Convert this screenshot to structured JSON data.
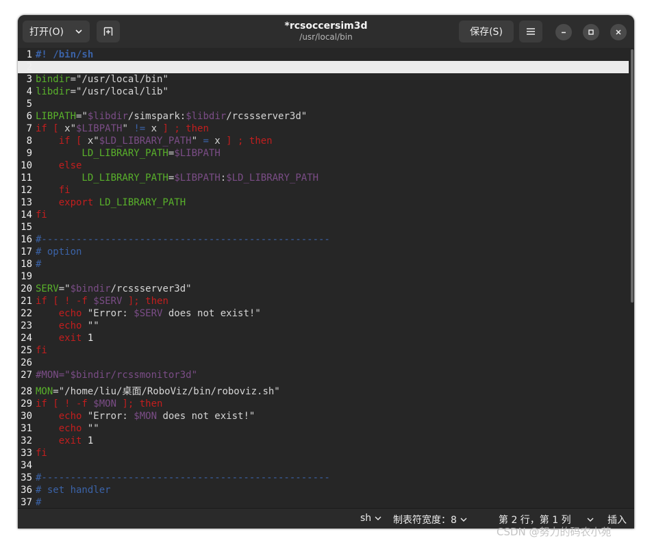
{
  "headerbar": {
    "open_label": "打开(O)",
    "title": "*rcsoccersim3d",
    "subtitle": "/usr/local/bin",
    "save_label": "保存(S)"
  },
  "code_lines": [
    {
      "n": "1",
      "tokens": [
        {
          "t": "#! /bin/sh",
          "c": "cmb"
        }
      ]
    },
    {
      "n": "2",
      "current": true,
      "tokens": []
    },
    {
      "n": "3",
      "tokens": [
        {
          "t": "bindir",
          "c": "var"
        },
        {
          "t": "=\"/usr/local/bin\"",
          "c": "str"
        }
      ]
    },
    {
      "n": "4",
      "tokens": [
        {
          "t": "libdir",
          "c": "var"
        },
        {
          "t": "=\"/usr/local/lib\"",
          "c": "str"
        }
      ]
    },
    {
      "n": "5",
      "tokens": []
    },
    {
      "n": "6",
      "tokens": [
        {
          "t": "LIBPATH",
          "c": "var"
        },
        {
          "t": "=\"",
          "c": "str"
        },
        {
          "t": "$libdir",
          "c": "sub"
        },
        {
          "t": "/simspark:",
          "c": "str"
        },
        {
          "t": "$libdir",
          "c": "sub"
        },
        {
          "t": "/rcssserver3d\"",
          "c": "str"
        }
      ]
    },
    {
      "n": "7",
      "tokens": [
        {
          "t": "if [ ",
          "c": "kw"
        },
        {
          "t": "x\"",
          "c": "str"
        },
        {
          "t": "$LIBPATH",
          "c": "sub"
        },
        {
          "t": "\" ",
          "c": "str"
        },
        {
          "t": "!=",
          "c": "cm"
        },
        {
          "t": " x ",
          "c": "str"
        },
        {
          "t": "] ; then",
          "c": "kw"
        }
      ]
    },
    {
      "n": "8",
      "tokens": [
        {
          "t": "    if [ ",
          "c": "kw"
        },
        {
          "t": "x\"",
          "c": "str"
        },
        {
          "t": "$LD_LIBRARY_PATH",
          "c": "sub"
        },
        {
          "t": "\" ",
          "c": "str"
        },
        {
          "t": "=",
          "c": "cm"
        },
        {
          "t": " x ",
          "c": "str"
        },
        {
          "t": "] ; then",
          "c": "kw"
        }
      ]
    },
    {
      "n": "9",
      "tokens": [
        {
          "t": "        LD_LIBRARY_PATH",
          "c": "var"
        },
        {
          "t": "=",
          "c": "str"
        },
        {
          "t": "$LIBPATH",
          "c": "sub"
        }
      ]
    },
    {
      "n": "10",
      "tokens": [
        {
          "t": "    else",
          "c": "kw"
        }
      ]
    },
    {
      "n": "11",
      "tokens": [
        {
          "t": "        LD_LIBRARY_PATH",
          "c": "var"
        },
        {
          "t": "=",
          "c": "str"
        },
        {
          "t": "$LIBPATH",
          "c": "sub"
        },
        {
          "t": ":",
          "c": "str"
        },
        {
          "t": "$LD_LIBRARY_PATH",
          "c": "sub"
        }
      ]
    },
    {
      "n": "12",
      "tokens": [
        {
          "t": "    fi",
          "c": "kw"
        }
      ]
    },
    {
      "n": "13",
      "tokens": [
        {
          "t": "    export ",
          "c": "kw"
        },
        {
          "t": "LD_LIBRARY_PATH",
          "c": "var"
        }
      ]
    },
    {
      "n": "14",
      "tokens": [
        {
          "t": "fi",
          "c": "kw"
        }
      ]
    },
    {
      "n": "15",
      "tokens": []
    },
    {
      "n": "16",
      "tokens": [
        {
          "t": "#--------------------------------------------------",
          "c": "cm"
        }
      ]
    },
    {
      "n": "17",
      "tokens": [
        {
          "t": "# option",
          "c": "cm"
        }
      ]
    },
    {
      "n": "18",
      "tokens": [
        {
          "t": "#",
          "c": "cm"
        }
      ]
    },
    {
      "n": "19",
      "tokens": []
    },
    {
      "n": "20",
      "tokens": [
        {
          "t": "SERV",
          "c": "var"
        },
        {
          "t": "=\"",
          "c": "str"
        },
        {
          "t": "$bindir",
          "c": "sub"
        },
        {
          "t": "/rcssserver3d\"",
          "c": "str"
        }
      ]
    },
    {
      "n": "21",
      "tokens": [
        {
          "t": "if [ ! -f ",
          "c": "kw"
        },
        {
          "t": "$SERV",
          "c": "sub"
        },
        {
          "t": " ]; then",
          "c": "kw"
        }
      ]
    },
    {
      "n": "22",
      "tokens": [
        {
          "t": "    echo ",
          "c": "kw"
        },
        {
          "t": "\"Error: ",
          "c": "str"
        },
        {
          "t": "$SERV",
          "c": "sub"
        },
        {
          "t": " does not exist!\"",
          "c": "str"
        }
      ]
    },
    {
      "n": "23",
      "tokens": [
        {
          "t": "    echo ",
          "c": "kw"
        },
        {
          "t": "\"\"",
          "c": "str"
        }
      ]
    },
    {
      "n": "24",
      "tokens": [
        {
          "t": "    exit ",
          "c": "kw"
        },
        {
          "t": "1",
          "c": "num"
        }
      ]
    },
    {
      "n": "25",
      "tokens": [
        {
          "t": "fi",
          "c": "kw"
        }
      ]
    },
    {
      "n": "26",
      "tokens": []
    },
    {
      "n": "27",
      "tokens": [
        {
          "t": "#MON=\"$bindir/rcssmonitor3d\"",
          "c": "sub"
        }
      ]
    },
    {
      "n": "28",
      "tokens": [
        {
          "t": "MON",
          "c": "var"
        },
        {
          "t": "=\"/home/liu/桌面/RoboViz/bin/roboviz.sh\"",
          "c": "str"
        }
      ]
    },
    {
      "n": "29",
      "tokens": [
        {
          "t": "if [ ! -f ",
          "c": "kw"
        },
        {
          "t": "$MON",
          "c": "sub"
        },
        {
          "t": " ]; then",
          "c": "kw"
        }
      ]
    },
    {
      "n": "30",
      "tokens": [
        {
          "t": "    echo ",
          "c": "kw"
        },
        {
          "t": "\"Error: ",
          "c": "str"
        },
        {
          "t": "$MON",
          "c": "sub"
        },
        {
          "t": " does not exist!\"",
          "c": "str"
        }
      ]
    },
    {
      "n": "31",
      "tokens": [
        {
          "t": "    echo ",
          "c": "kw"
        },
        {
          "t": "\"\"",
          "c": "str"
        }
      ]
    },
    {
      "n": "32",
      "tokens": [
        {
          "t": "    exit ",
          "c": "kw"
        },
        {
          "t": "1",
          "c": "num"
        }
      ]
    },
    {
      "n": "33",
      "tokens": [
        {
          "t": "fi",
          "c": "kw"
        }
      ]
    },
    {
      "n": "34",
      "tokens": []
    },
    {
      "n": "35",
      "tokens": [
        {
          "t": "#--------------------------------------------------",
          "c": "cm"
        }
      ]
    },
    {
      "n": "36",
      "tokens": [
        {
          "t": "# set handler",
          "c": "cm"
        }
      ]
    },
    {
      "n": "37",
      "tokens": [
        {
          "t": "#",
          "c": "cm"
        }
      ]
    }
  ],
  "statusbar": {
    "language": "sh",
    "tab_width": "制表符宽度：8",
    "position": "第 2 行，第 1 列",
    "mode": "插入"
  },
  "watermark": "CSDN @努力的码农小苑",
  "icons": {
    "open_dropdown": "chevron-down-icon",
    "new_tab": "new-tab-icon",
    "menu": "hamburger-menu-icon",
    "minimize": "minimize-icon",
    "maximize": "maximize-icon",
    "close": "close-icon"
  }
}
